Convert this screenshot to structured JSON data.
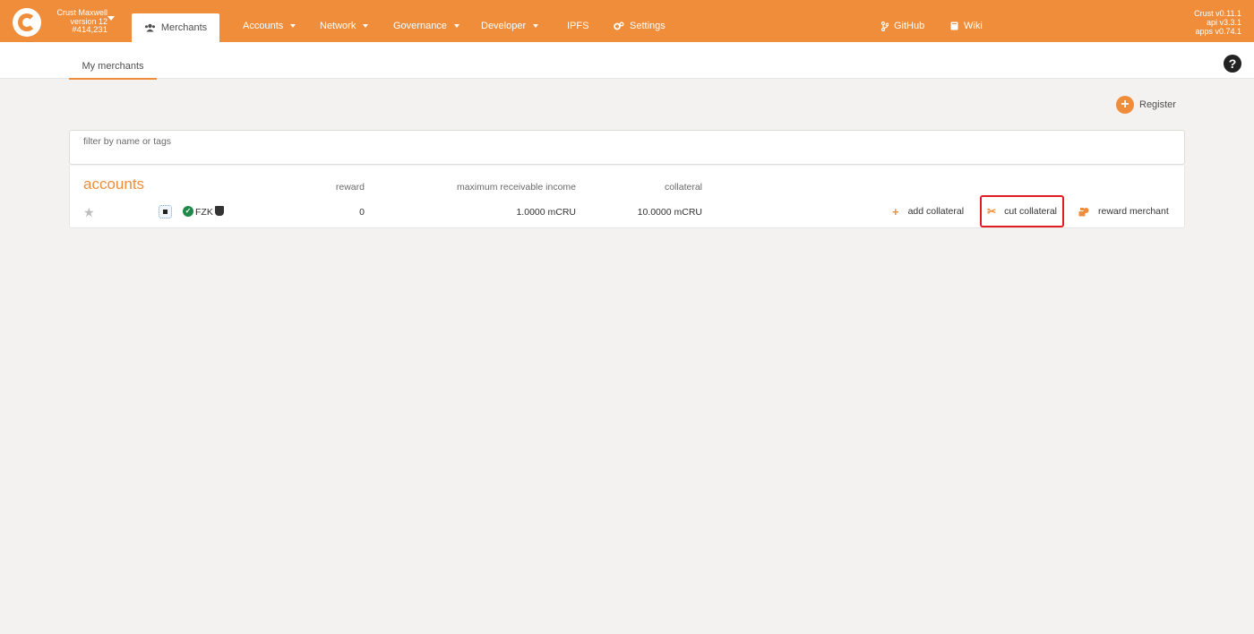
{
  "header": {
    "chain_name": "Crust Maxwell",
    "chain_version": "version 12",
    "block_number": "#414,231",
    "active_tab": "Merchants",
    "nav": [
      {
        "label": "Accounts"
      },
      {
        "label": "Network"
      },
      {
        "label": "Governance"
      },
      {
        "label": "Developer"
      },
      {
        "label": "IPFS"
      },
      {
        "label": "Settings"
      }
    ],
    "links": [
      {
        "label": "GitHub"
      },
      {
        "label": "Wiki"
      }
    ],
    "versions": [
      "Crust v0.11.1",
      "api v3.3.1",
      "apps v0.74.1"
    ]
  },
  "tabs": {
    "my_merchants": "My merchants",
    "help": "?"
  },
  "register_label": "Register",
  "filter": {
    "placeholder": "filter by name or tags",
    "value": ""
  },
  "table": {
    "title": "accounts",
    "headers": {
      "reward": "reward",
      "max_income": "maximum receivable income",
      "collateral": "collateral"
    },
    "row": {
      "name": "FZK",
      "reward": "0",
      "max_income": "1.0000 mCRU",
      "collateral": "10.0000 mCRU"
    },
    "actions": {
      "add": "add collateral",
      "cut": "cut collateral",
      "reward": "reward merchant"
    }
  },
  "colors": {
    "accent": "#f08d3a",
    "highlight": "#e11c22",
    "verified": "#1e8a4a"
  }
}
